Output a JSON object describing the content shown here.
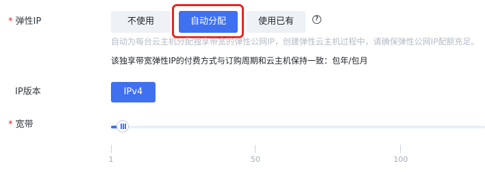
{
  "eip": {
    "label": "弹性IP",
    "required_mark": "*",
    "options": [
      "不使用",
      "自动分配",
      "使用已有"
    ],
    "selected": "自动分配",
    "help_icon": "question-circle-icon",
    "help_glyph": "?",
    "hint": "自动为每台云主机分配独享带宽的弹性公网IP，创建弹性云主机过程中，请确保弹性公网IP配额充足。",
    "billing_note": "该独享带宽弹性IP的付费方式与订购周期和云主机保持一致：包年/包月"
  },
  "ip_version": {
    "label": "IP版本",
    "value": "IPv4"
  },
  "bandwidth": {
    "label": "宽带",
    "required_mark": "*",
    "value": 2,
    "ticks": [
      "1",
      "50",
      "100"
    ]
  },
  "colors": {
    "accent": "#3f70f0",
    "highlight": "#e8241f"
  }
}
